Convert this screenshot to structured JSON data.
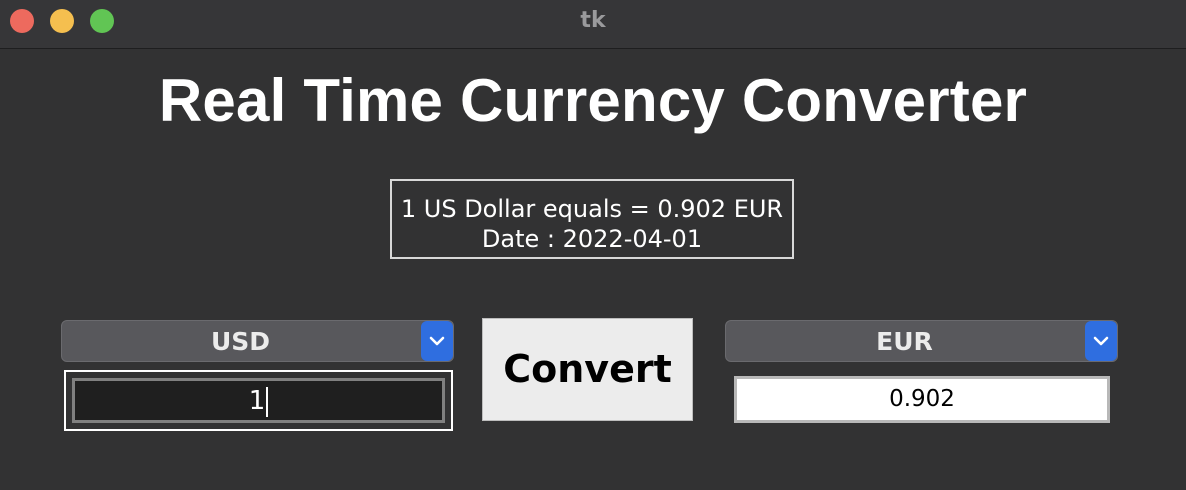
{
  "window": {
    "title": "tk"
  },
  "app": {
    "heading": "Real Time Currency Converter"
  },
  "rate_info": {
    "line1": "1 US Dollar equals = 0.902 EUR",
    "line2": "Date : 2022-04-01"
  },
  "from_currency": {
    "selected": "USD",
    "amount": "1"
  },
  "to_currency": {
    "selected": "EUR",
    "result": "0.902"
  },
  "convert_button": {
    "label": "Convert"
  },
  "icons": {
    "close": "close-icon",
    "minimize": "minimize-icon",
    "maximize": "maximize-icon",
    "dropdown": "chevron-down-icon"
  },
  "colors": {
    "accent": "#2f6ee0",
    "background": "#323233"
  }
}
